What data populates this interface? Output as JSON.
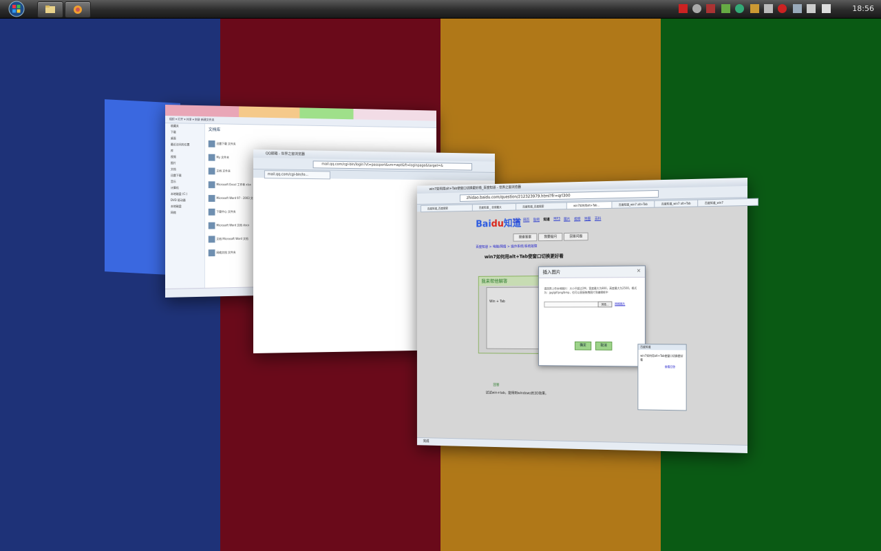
{
  "desktop": {
    "stripe_colors": [
      "#1e3278",
      "#6a0a1a",
      "#b07818",
      "#0a5a14"
    ]
  },
  "taskbar": {
    "clock": "18:56"
  },
  "explorer": {
    "title": "文档库",
    "menu": "组织 ▾   打开 ▾   共享 ▾   刻录   新建文件夹",
    "sidebar": [
      "收藏夹",
      "下载",
      "桌面",
      "最近访问的位置",
      "库",
      "视频",
      "图片",
      "文档",
      "迅雷下载",
      "音乐",
      "计算机",
      "本地磁盘 (C:)",
      "DVD 驱动器",
      "本地磁盘",
      "网络"
    ],
    "files": [
      {
        "name": "迅雷下载",
        "meta": "文件夹"
      },
      {
        "name": "My",
        "meta": "文件夹"
      },
      {
        "name": "文档",
        "meta": "文件夹"
      },
      {
        "name": "Microsoft Excel 工作表",
        "meta": "xlsx"
      },
      {
        "name": "Microsoft Word 97 - 2003 文档",
        "meta": "doc"
      },
      {
        "name": "下载中心",
        "meta": "文件夹"
      },
      {
        "name": "Microsoft Word 文档",
        "meta": "docx"
      },
      {
        "name": "文档",
        "meta": "Microsoft Word 文档"
      },
      {
        "name": "网络文档",
        "meta": "文件夹"
      }
    ]
  },
  "qqbrowser": {
    "title": "QQ邮箱 - 世界之窗浏览器",
    "address": "mail.qq.com/cgi-bin/login?vt=passport&vm=wpt&ft=loginpage&target=&",
    "tab": "mail.qq.com/cgi-bin/lo..."
  },
  "baidu": {
    "title": "win7如何用alt+Tab使窗口切换更好看_百度知道 - 世界之窗浏览器",
    "address": "zhidao.baidu.com/question/212323979.html?fr=qrl300",
    "tabs": [
      "百度知道_百度搜索",
      "百度知道 _ 全球最大",
      "百度知道_百度搜索",
      "win7如何用alt+Tab...",
      "百度知道_win7 alt+Tab",
      "百度知道_win7 alt+Tab",
      "百度知道_win7"
    ],
    "categories": [
      "新闻",
      "网页",
      "贴吧",
      "知道",
      "MP3",
      "图片",
      "视频",
      "地图",
      "百科",
      "文库"
    ],
    "buttons": [
      "搜索答案",
      "我要提问",
      "回答问题"
    ],
    "breadcrumb": "百度知道 > 电脑/网络 > 操作系统/系统故障",
    "question": "win7如何用alt+Tab使窗口切换更好看",
    "answer_header": "我来帮他解答",
    "answer_text": "Win + Tab",
    "reply_label": "回答",
    "reply_text": "试试win+tab，能得到windows的3D效果。",
    "status": "完成",
    "dialog": {
      "title": "插入图片",
      "close": "×",
      "desc": "请选择上传本地图片：大小不超过2M，宽度最大为800，高度最大为2500，格式为：jpg/gif/png/bmp，也可以直接拖拽图片到编辑框中",
      "browse": "浏览...",
      "link": "网络图片",
      "ok": "确定",
      "cancel": "取消"
    },
    "popup": {
      "title": "百度知道",
      "text": "win7如何用alt+Tab使窗口切换更好看",
      "link": "查看回答"
    }
  }
}
